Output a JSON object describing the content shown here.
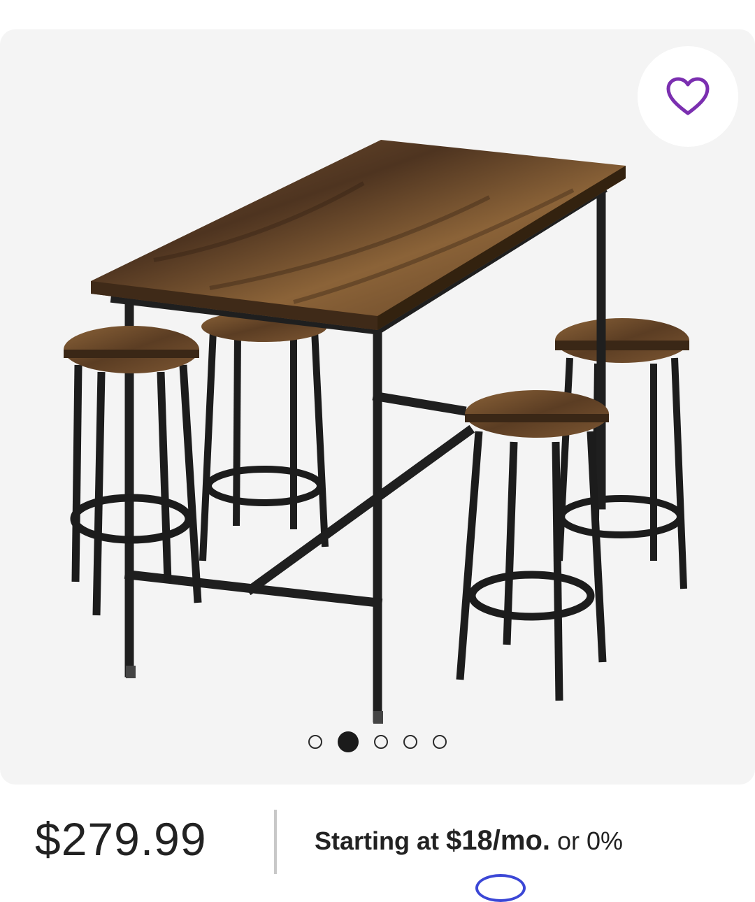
{
  "product": {
    "favorite_icon": "heart-outline-icon",
    "image_icon": "bar-table-with-four-stools",
    "carousel": {
      "total": 5,
      "active_index": 1
    }
  },
  "pricing": {
    "price": "$279.99",
    "financing_lead": "Starting at",
    "financing_amount": "$18/mo.",
    "financing_rest": "or 0%"
  },
  "colors": {
    "accent": "#7b2fb0",
    "card_bg": "#f4f4f4",
    "wood": "#6b4a2b",
    "metal": "#1c1c1c"
  }
}
